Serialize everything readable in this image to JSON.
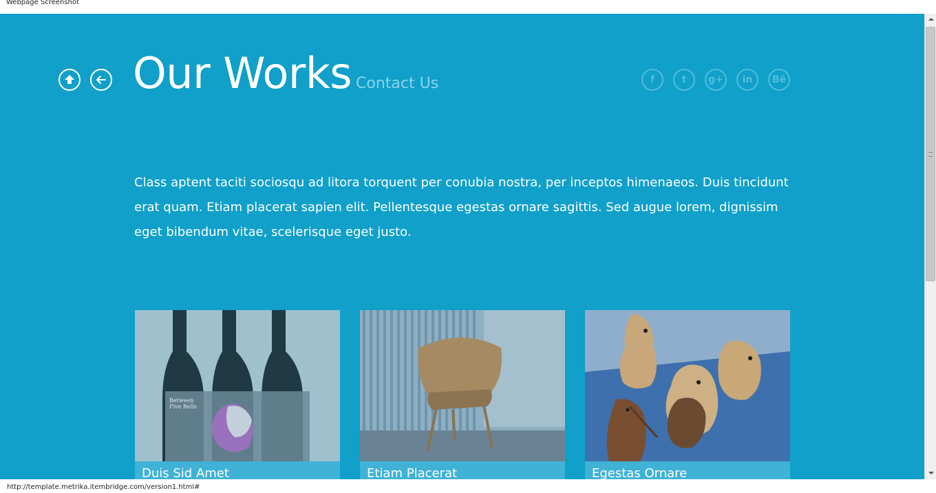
{
  "browser": {
    "title": "Webpage Screenshot",
    "status_url": "http://template.metrika.itembridge.com/version1.html#"
  },
  "header": {
    "title": "Our Works",
    "contact_link": "Contact Us",
    "nav_icons": [
      "home-icon",
      "back-arrow-icon"
    ],
    "social": [
      {
        "name": "facebook-icon",
        "glyph": "f"
      },
      {
        "name": "twitter-icon",
        "glyph": "t"
      },
      {
        "name": "google-plus-icon",
        "glyph": "g+"
      },
      {
        "name": "linkedin-icon",
        "glyph": "in"
      },
      {
        "name": "behance-icon",
        "glyph": "Bē"
      }
    ]
  },
  "main": {
    "intro": "Class aptent taciti sociosqu ad litora torquent per conubia nostra, per inceptos himenaeos. Duis tincidunt erat quam. Etiam placerat sapien elit. Pellentesque egestas ornare sagittis. Sed augue lorem, dignissim eget bibendum vitae, scelerisque eget justo.",
    "works": [
      {
        "title": "Duis Sid Amet",
        "image": "wine-bottles-image"
      },
      {
        "title": "Etiam Placerat",
        "image": "chair-image"
      },
      {
        "title": "Egestas Ornare",
        "image": "wooden-birds-image"
      }
    ]
  },
  "colors": {
    "background": "#10a0c9",
    "caption_bar": "#3fb2d6",
    "contact_link": "#8bd4ec",
    "social_icons": "#54bcdc"
  }
}
